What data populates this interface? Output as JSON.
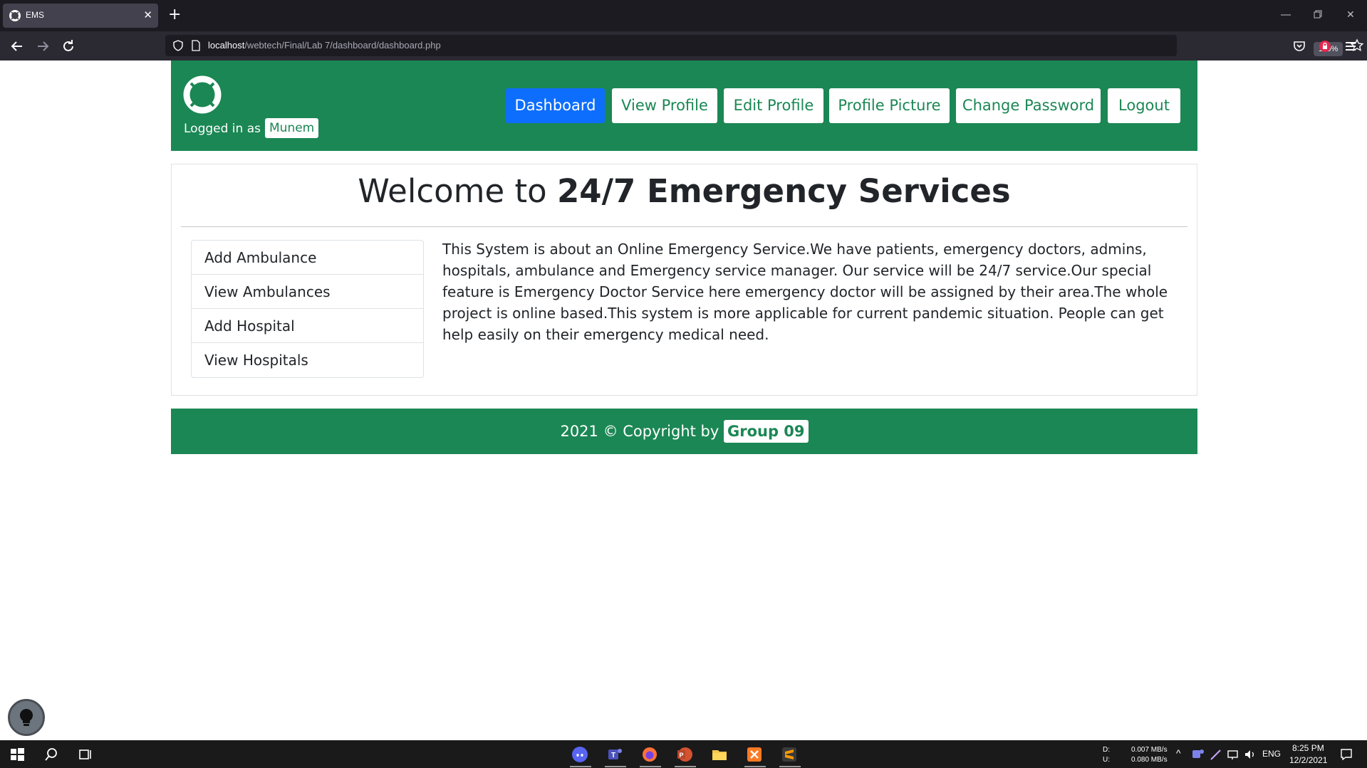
{
  "browser": {
    "tab_title": "EMS",
    "tab_close": "✕",
    "new_tab": "+",
    "url_host": "localhost",
    "url_path": "/webtech/Final/Lab 7/dashboard/dashboard.php",
    "zoom": "110%"
  },
  "header": {
    "logged_in_label": "Logged in as",
    "username": "Munem",
    "nav": {
      "dashboard": "Dashboard",
      "view_profile": "View Profile",
      "edit_profile": "Edit Profile",
      "profile_picture": "Profile Picture",
      "change_password": "Change Password",
      "logout": "Logout"
    },
    "brand_color": "#1b8754",
    "active_color": "#0d6efd"
  },
  "main": {
    "welcome_prefix": "Welcome to",
    "welcome_bold": "24/7 Emergency Services",
    "sidebar": [
      "Add Ambulance",
      "View Ambulances",
      "Add Hospital",
      "View Hospitals"
    ],
    "about": "This System is about an Online Emergency Service.We have patients, emergency doctors, admins, hospitals, ambulance and Emergency service manager. Our service will be 24/7 service.Our special feature is Emergency Doctor Service here emergency doctor will be assigned by their area.The whole project is online based.This system is more applicable for current pandemic situation. People can get help easily on their emergency medical need."
  },
  "footer": {
    "text": "2021 © Copyright by",
    "group": "Group 09"
  },
  "taskbar": {
    "drive_d": "D:",
    "drive_u": "U:",
    "net_down": "0.007 MB/s",
    "net_up": "0.080 MB/s",
    "language": "ENG",
    "time": "8:25 PM",
    "date": "12/2/2021"
  }
}
